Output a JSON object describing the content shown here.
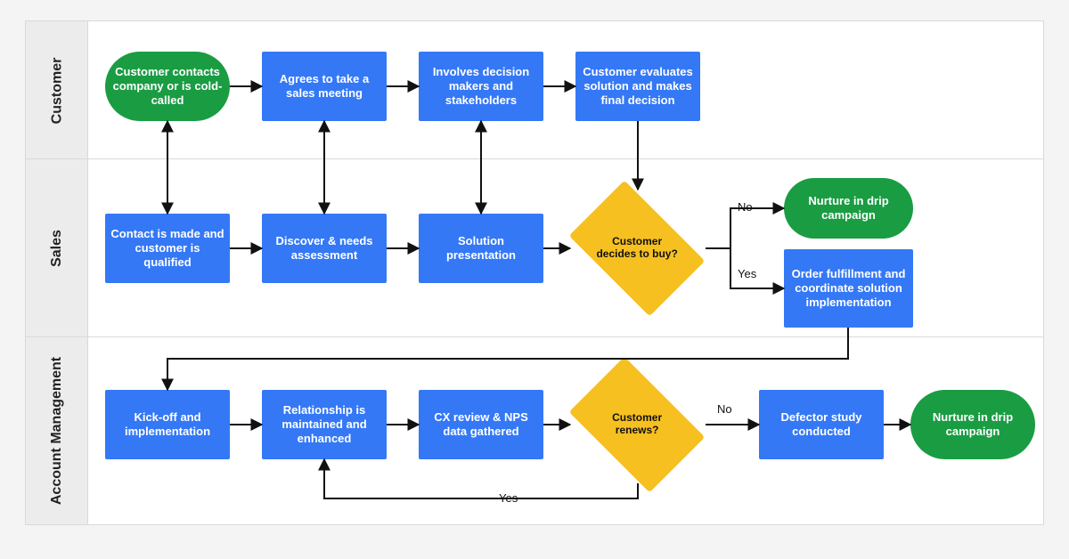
{
  "swimlanes": {
    "l1": "Customer",
    "l2": "Sales",
    "l3": "Account Management"
  },
  "customer": {
    "n1": "Customer contacts company or is cold-called",
    "n2": "Agrees to take a sales meeting",
    "n3": "Involves decision makers and stakeholders",
    "n4": "Customer evaluates solution and makes final decision"
  },
  "sales": {
    "n1": "Contact is made and customer is qualified",
    "n2": "Discover & needs assessment",
    "n3": "Solution presentation",
    "d1": "Customer decides to buy?",
    "out_top": "Nurture in drip campaign",
    "out_bottom": "Order fulfillment and coordinate solution implementation",
    "no": "No",
    "yes": "Yes"
  },
  "am": {
    "n1": "Kick-off and implementation",
    "n2": "Relationship is maintained and enhanced",
    "n3": "CX review & NPS data gathered",
    "d1": "Customer renews?",
    "n4": "Defector study conducted",
    "n5": "Nurture in drip campaign",
    "no": "No",
    "yes": "Yes"
  }
}
